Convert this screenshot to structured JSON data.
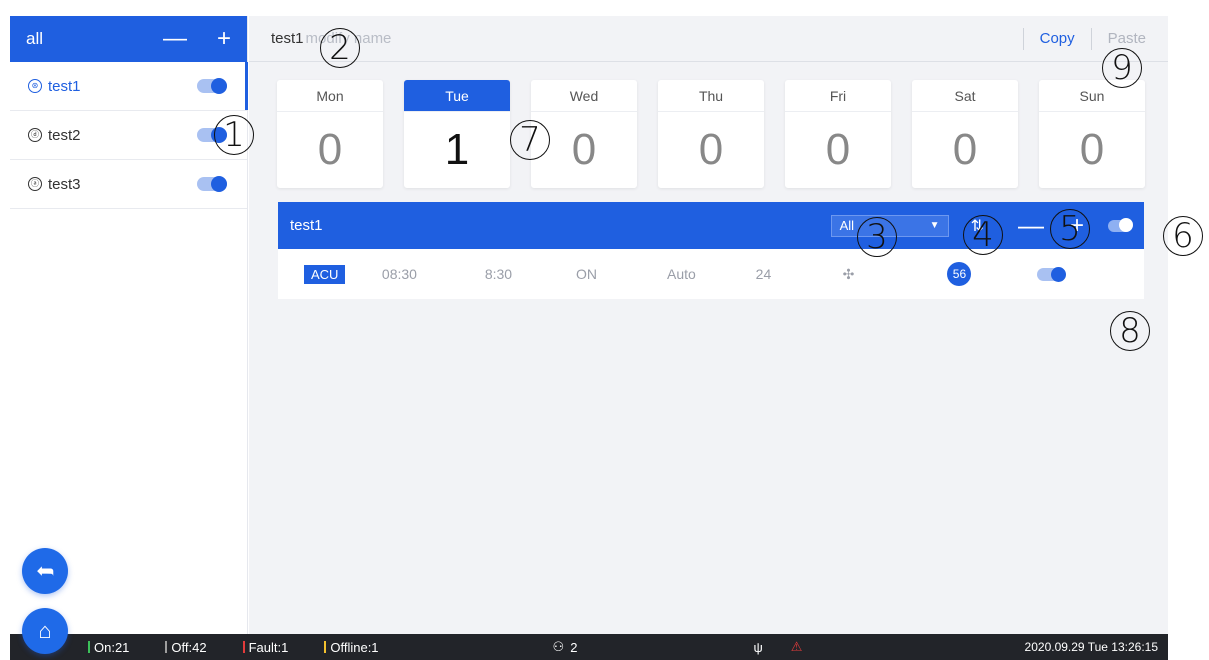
{
  "sidebar": {
    "header_title": "all",
    "minus": "—",
    "plus": "+",
    "groups": [
      {
        "label": "test1",
        "icon": "⊛"
      },
      {
        "label": "test2",
        "icon": "ⓓ"
      },
      {
        "label": "test3",
        "icon": "ⓐ"
      }
    ],
    "back_icon": "➦",
    "home_icon": "⌂"
  },
  "toolbar": {
    "schedule_name": "test1",
    "modify_placeholder": "modify name",
    "copy_label": "Copy",
    "paste_label": "Paste"
  },
  "days": [
    {
      "name": "Mon",
      "count": "0"
    },
    {
      "name": "Tue",
      "count": "1"
    },
    {
      "name": "Wed",
      "count": "0"
    },
    {
      "name": "Thu",
      "count": "0"
    },
    {
      "name": "Fri",
      "count": "0"
    },
    {
      "name": "Sat",
      "count": "0"
    },
    {
      "name": "Sun",
      "count": "0"
    }
  ],
  "schedule_bar": {
    "title": "test1",
    "select_value": "All",
    "minus": "—",
    "plus": "+"
  },
  "schedule_row": {
    "type_tag": "ACU",
    "start": "08:30",
    "time2": "8:30",
    "state": "ON",
    "mode": "Auto",
    "temp": "24",
    "fan_icon": "✣",
    "count": "56"
  },
  "annotations": [
    "1",
    "2",
    "3",
    "4",
    "5",
    "6",
    "7",
    "8",
    "9"
  ],
  "status": {
    "on": "On:21",
    "off": "Off:42",
    "fault": "Fault:1",
    "offline": "Offline:1",
    "users": "2",
    "datetime": "2020.09.29   Tue   13:26:15"
  },
  "colors": {
    "primary": "#1f5fe0",
    "on": "#3cc15a",
    "off": "#9e9e9e",
    "fault": "#e23b3b",
    "offline": "#f3c12f"
  }
}
